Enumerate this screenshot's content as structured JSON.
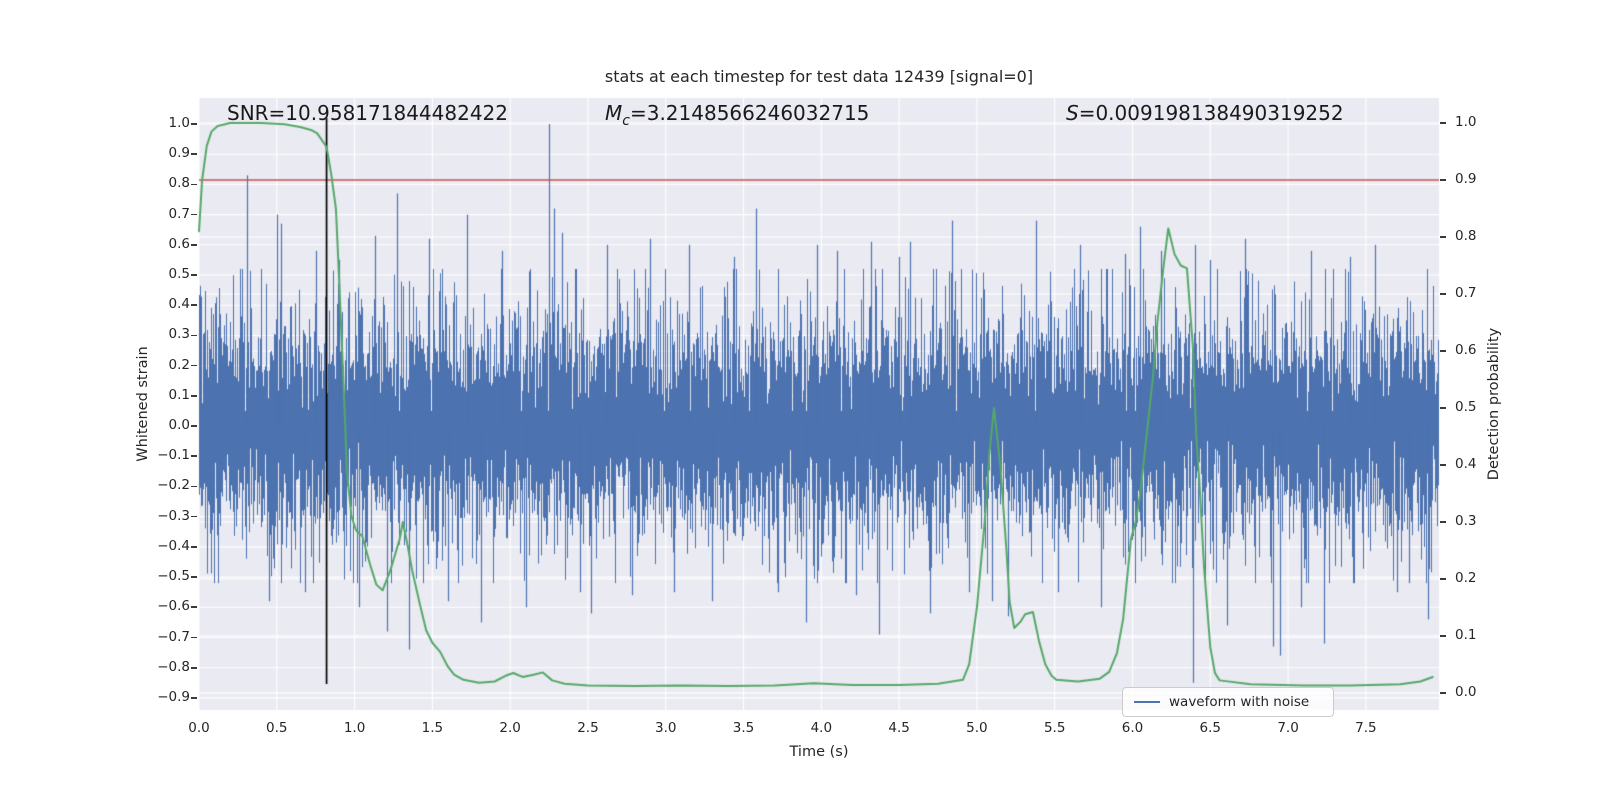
{
  "figure": {
    "background": "#ffffff",
    "plot_background": "#eaeaf2",
    "grid_color": "#ffffff",
    "text_color": "#262626"
  },
  "annotations": {
    "snr": "SNR=10.958171844482422",
    "mc_symbol": "M",
    "mc_subscript": "c",
    "mc_value": "=3.2148566246032715",
    "s_symbol": "S",
    "s_value": "=0.009198138490319252"
  },
  "chart_data": {
    "type": "line",
    "title": "stats at each timestep for test data 12439 [signal=0]",
    "xlabel": "Time (s)",
    "ylabel_left": "Whitened strain",
    "ylabel_right": "Detection probability",
    "xlim": [
      0,
      7.97
    ],
    "ylim_left": [
      -0.94,
      1.086
    ],
    "ylim_right": [
      -0.03,
      1.044
    ],
    "x_ticks": [
      0.0,
      0.5,
      1.0,
      1.5,
      2.0,
      2.5,
      3.0,
      3.5,
      4.0,
      4.5,
      5.0,
      5.5,
      6.0,
      6.5,
      7.0,
      7.5
    ],
    "y_ticks_left": [
      1.0,
      0.9,
      0.8,
      0.7,
      0.6,
      0.5,
      0.4,
      0.3,
      0.2,
      0.1,
      0.0,
      -0.1,
      -0.2,
      -0.3,
      -0.4,
      -0.5,
      -0.6,
      -0.7,
      -0.8,
      -0.9
    ],
    "y_ticks_right": [
      1.0,
      0.9,
      0.8,
      0.7,
      0.6,
      0.5,
      0.4,
      0.3,
      0.2,
      0.1,
      0.0
    ],
    "grid": true,
    "legend": {
      "label": "waveform with noise",
      "loc": "lower right"
    },
    "series": {
      "waveform": {
        "name": "waveform with noise",
        "color": "#4c72b0",
        "axis": "left",
        "noise": {
          "seed": 20439,
          "sigma": 0.16,
          "samples_per_column": 9,
          "excursion_prob": 0.3,
          "excursion_scale": 0.1,
          "max_abs": 0.52
        },
        "spikes": [
          [
            0.31,
            0.83
          ],
          [
            0.45,
            -0.58
          ],
          [
            0.5,
            0.7
          ],
          [
            0.53,
            0.67
          ],
          [
            0.68,
            -0.55
          ],
          [
            0.75,
            0.58
          ],
          [
            0.9,
            0.55
          ],
          [
            1.03,
            -0.6
          ],
          [
            1.13,
            0.63
          ],
          [
            1.21,
            -0.68
          ],
          [
            1.27,
            0.77
          ],
          [
            1.35,
            -0.74
          ],
          [
            1.48,
            0.62
          ],
          [
            1.6,
            -0.58
          ],
          [
            1.72,
            0.7
          ],
          [
            1.81,
            -0.65
          ],
          [
            1.95,
            0.58
          ],
          [
            2.1,
            -0.6
          ],
          [
            2.25,
            1.0
          ],
          [
            2.28,
            0.72
          ],
          [
            2.33,
            0.64
          ],
          [
            2.45,
            -0.55
          ],
          [
            2.52,
            -0.62
          ],
          [
            2.62,
            0.6
          ],
          [
            2.78,
            -0.56
          ],
          [
            2.9,
            0.62
          ],
          [
            3.05,
            -0.55
          ],
          [
            3.15,
            0.6
          ],
          [
            3.3,
            -0.58
          ],
          [
            3.44,
            0.56
          ],
          [
            3.58,
            0.72
          ],
          [
            3.72,
            -0.55
          ],
          [
            3.9,
            -0.65
          ],
          [
            3.97,
            0.6
          ],
          [
            4.1,
            0.58
          ],
          [
            4.22,
            -0.56
          ],
          [
            4.32,
            0.61
          ],
          [
            4.37,
            -0.69
          ],
          [
            4.5,
            0.56
          ],
          [
            4.57,
            0.61
          ],
          [
            4.7,
            -0.62
          ],
          [
            4.84,
            0.68
          ],
          [
            4.95,
            -0.55
          ],
          [
            5.1,
            -0.58
          ],
          [
            5.2,
            -0.63
          ],
          [
            5.38,
            0.68
          ],
          [
            5.52,
            -0.55
          ],
          [
            5.66,
            0.6
          ],
          [
            5.8,
            -0.6
          ],
          [
            5.95,
            0.57
          ],
          [
            6.05,
            0.66
          ],
          [
            6.18,
            0.58
          ],
          [
            6.39,
            -0.85
          ],
          [
            6.4,
            0.6
          ],
          [
            6.5,
            0.55
          ],
          [
            6.61,
            -0.66
          ],
          [
            6.72,
            0.62
          ],
          [
            6.9,
            -0.73
          ],
          [
            6.95,
            -0.76
          ],
          [
            7.08,
            -0.6
          ],
          [
            7.15,
            0.58
          ],
          [
            7.23,
            -0.72
          ],
          [
            7.4,
            0.56
          ],
          [
            7.56,
            0.6
          ],
          [
            7.7,
            -0.55
          ],
          [
            7.78,
            -0.52
          ],
          [
            7.9,
            -0.64
          ]
        ]
      },
      "detection_probability": {
        "name": "detection probability",
        "color": "#55a868",
        "axis": "right",
        "points": [
          [
            0.0,
            0.81
          ],
          [
            0.02,
            0.9
          ],
          [
            0.05,
            0.96
          ],
          [
            0.08,
            0.985
          ],
          [
            0.12,
            0.995
          ],
          [
            0.2,
            1.0
          ],
          [
            0.4,
            1.0
          ],
          [
            0.55,
            0.998
          ],
          [
            0.65,
            0.993
          ],
          [
            0.72,
            0.988
          ],
          [
            0.76,
            0.982
          ],
          [
            0.82,
            0.958
          ],
          [
            0.85,
            0.91
          ],
          [
            0.88,
            0.85
          ],
          [
            0.9,
            0.73
          ],
          [
            0.92,
            0.6
          ],
          [
            0.94,
            0.47
          ],
          [
            0.95,
            0.39
          ],
          [
            0.98,
            0.31
          ],
          [
            1.01,
            0.285
          ],
          [
            1.05,
            0.275
          ],
          [
            1.1,
            0.225
          ],
          [
            1.14,
            0.19
          ],
          [
            1.18,
            0.18
          ],
          [
            1.23,
            0.215
          ],
          [
            1.29,
            0.27
          ],
          [
            1.31,
            0.3
          ],
          [
            1.34,
            0.26
          ],
          [
            1.37,
            0.215
          ],
          [
            1.42,
            0.155
          ],
          [
            1.46,
            0.11
          ],
          [
            1.5,
            0.088
          ],
          [
            1.55,
            0.072
          ],
          [
            1.6,
            0.046
          ],
          [
            1.64,
            0.032
          ],
          [
            1.7,
            0.023
          ],
          [
            1.8,
            0.018
          ],
          [
            1.9,
            0.02
          ],
          [
            1.97,
            0.03
          ],
          [
            2.02,
            0.035
          ],
          [
            2.08,
            0.028
          ],
          [
            2.15,
            0.032
          ],
          [
            2.21,
            0.036
          ],
          [
            2.27,
            0.022
          ],
          [
            2.35,
            0.016
          ],
          [
            2.5,
            0.013
          ],
          [
            2.8,
            0.012
          ],
          [
            3.1,
            0.013
          ],
          [
            3.4,
            0.012
          ],
          [
            3.7,
            0.013
          ],
          [
            3.95,
            0.017
          ],
          [
            4.2,
            0.014
          ],
          [
            4.5,
            0.014
          ],
          [
            4.75,
            0.016
          ],
          [
            4.91,
            0.023
          ],
          [
            4.95,
            0.05
          ],
          [
            5.0,
            0.15
          ],
          [
            5.05,
            0.3
          ],
          [
            5.08,
            0.42
          ],
          [
            5.11,
            0.5
          ],
          [
            5.15,
            0.4
          ],
          [
            5.19,
            0.25
          ],
          [
            5.21,
            0.16
          ],
          [
            5.24,
            0.114
          ],
          [
            5.28,
            0.125
          ],
          [
            5.31,
            0.138
          ],
          [
            5.36,
            0.142
          ],
          [
            5.4,
            0.09
          ],
          [
            5.44,
            0.05
          ],
          [
            5.48,
            0.03
          ],
          [
            5.51,
            0.023
          ],
          [
            5.65,
            0.02
          ],
          [
            5.79,
            0.025
          ],
          [
            5.85,
            0.037
          ],
          [
            5.9,
            0.07
          ],
          [
            5.94,
            0.13
          ],
          [
            5.99,
            0.27
          ],
          [
            6.02,
            0.3
          ],
          [
            6.05,
            0.35
          ],
          [
            6.09,
            0.45
          ],
          [
            6.13,
            0.55
          ],
          [
            6.16,
            0.65
          ],
          [
            6.2,
            0.75
          ],
          [
            6.23,
            0.815
          ],
          [
            6.27,
            0.77
          ],
          [
            6.31,
            0.75
          ],
          [
            6.35,
            0.745
          ],
          [
            6.39,
            0.6
          ],
          [
            6.41,
            0.45
          ],
          [
            6.43,
            0.37
          ],
          [
            6.46,
            0.22
          ],
          [
            6.48,
            0.15
          ],
          [
            6.5,
            0.08
          ],
          [
            6.53,
            0.035
          ],
          [
            6.56,
            0.022
          ],
          [
            6.76,
            0.015
          ],
          [
            7.1,
            0.013
          ],
          [
            7.4,
            0.013
          ],
          [
            7.72,
            0.015
          ],
          [
            7.85,
            0.02
          ],
          [
            7.93,
            0.028
          ]
        ]
      },
      "threshold": {
        "name": "detection threshold",
        "color": "#c44e52",
        "axis": "right",
        "value": 0.9
      },
      "event_marker": {
        "name": "event time marker",
        "color": "#000000",
        "t": 0.82
      }
    }
  }
}
